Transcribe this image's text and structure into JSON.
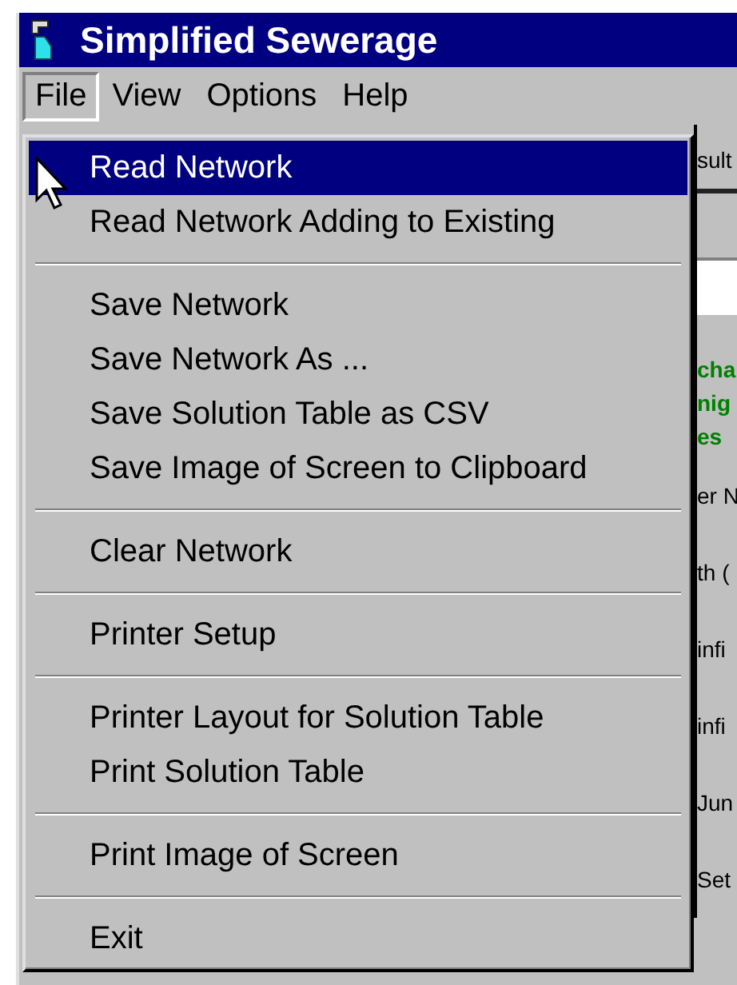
{
  "window": {
    "title": "Simplified Sewerage"
  },
  "menu_bar": [
    {
      "label": "File",
      "selected": true
    },
    {
      "label": "View",
      "selected": false
    },
    {
      "label": "Options",
      "selected": false
    },
    {
      "label": "Help",
      "selected": false
    }
  ],
  "file_menu": [
    {
      "kind": "item",
      "label": "Read Network",
      "selected": true
    },
    {
      "kind": "item",
      "label": "Read Network Adding to Existing",
      "selected": false
    },
    {
      "kind": "separator"
    },
    {
      "kind": "item",
      "label": "Save Network",
      "selected": false
    },
    {
      "kind": "item",
      "label": "Save Network As ...",
      "selected": false
    },
    {
      "kind": "item",
      "label": "Save Solution Table as CSV",
      "selected": false
    },
    {
      "kind": "item",
      "label": "Save Image of Screen to Clipboard",
      "selected": false
    },
    {
      "kind": "separator"
    },
    {
      "kind": "item",
      "label": "Clear Network",
      "selected": false
    },
    {
      "kind": "separator"
    },
    {
      "kind": "item",
      "label": "Printer Setup",
      "selected": false
    },
    {
      "kind": "separator"
    },
    {
      "kind": "item",
      "label": "Printer Layout for Solution Table",
      "selected": false
    },
    {
      "kind": "item",
      "label": "Print Solution Table",
      "selected": false
    },
    {
      "kind": "separator"
    },
    {
      "kind": "item",
      "label": "Print Image of Screen",
      "selected": false
    },
    {
      "kind": "separator"
    },
    {
      "kind": "item",
      "label": "Exit",
      "selected": false
    }
  ],
  "background_window": [
    {
      "kind": "tab",
      "text": "sult"
    },
    {
      "kind": "field"
    },
    {
      "kind": "heading",
      "text": "cha"
    },
    {
      "kind": "heading",
      "text": "nig"
    },
    {
      "kind": "heading",
      "text": "es"
    },
    {
      "kind": "label",
      "text": "er N"
    },
    {
      "kind": "label",
      "text": "th ("
    },
    {
      "kind": "label",
      "text": "infi"
    },
    {
      "kind": "label",
      "text": "infi"
    },
    {
      "kind": "label",
      "text": "Jun"
    },
    {
      "kind": "label",
      "text": "Set"
    }
  ]
}
